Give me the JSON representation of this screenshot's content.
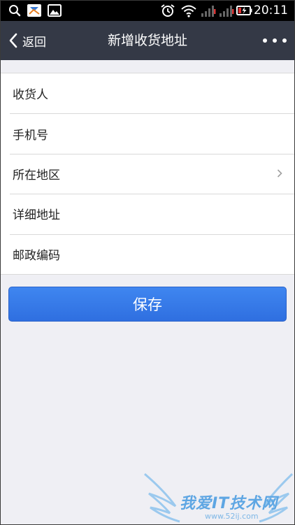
{
  "status_bar": {
    "time": "20:11",
    "icons": [
      "search-icon",
      "app-notification-icon",
      "gallery-icon",
      "alarm-icon",
      "wifi-icon",
      "signal-icon",
      "signal-icon",
      "battery-charging-icon"
    ]
  },
  "nav": {
    "back_label": "返回",
    "title": "新增收货地址",
    "more_icon": "more-icon"
  },
  "form": {
    "fields": [
      {
        "label": "收货人"
      },
      {
        "label": "手机号"
      },
      {
        "label": "所在地区"
      },
      {
        "label": "详细地址"
      },
      {
        "label": "邮政编码"
      }
    ]
  },
  "actions": {
    "save_label": "保存"
  },
  "watermark": {
    "text": "我爱IT技术网",
    "url": "www.52ij.com"
  },
  "colors": {
    "nav_background": "#343946",
    "page_background": "#efeff4",
    "primary_button": "#3478ea"
  }
}
